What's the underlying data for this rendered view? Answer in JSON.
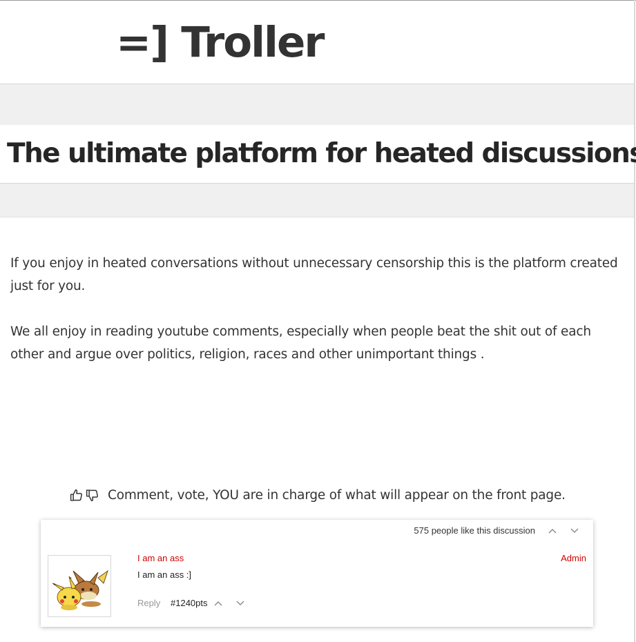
{
  "header": {
    "logo": "=] Troller"
  },
  "hero": {
    "headline": "The ultimate platform for heated discussions!"
  },
  "intro": {
    "paragraphs": [
      "If you enjoy in heated conversations without unnecessary censorship this is the platform created just for you.",
      "We all enjoy in reading youtube comments, especially when people beat the shit out of each other and argue over politics, religion, races and other unimportant things ."
    ]
  },
  "tagline": {
    "text": "Comment, vote, YOU are in charge of what will appear on the front page.",
    "icons": [
      "thumbs-up-icon",
      "thumbs-down-icon"
    ]
  },
  "discussion": {
    "likes_text": "575 people like this discussion",
    "comment": {
      "author": "I am an ass",
      "role": "Admin",
      "text": "I am an ass :]",
      "reply_label": "Reply",
      "points": "#1240pts"
    },
    "colors": {
      "author": "#d00000",
      "role": "#d00000",
      "reply": "#999999"
    }
  }
}
